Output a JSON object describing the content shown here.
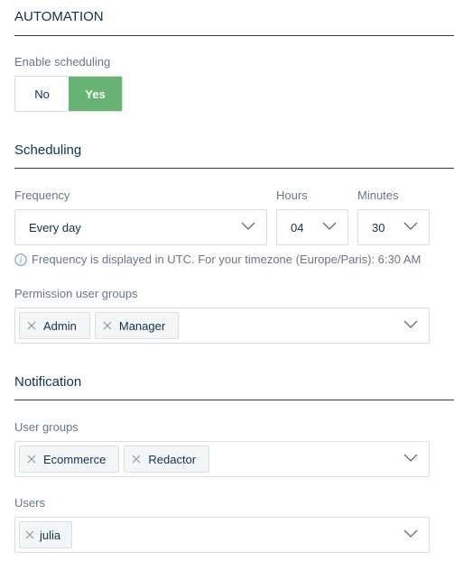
{
  "automation": {
    "title": "AUTOMATION",
    "enable_scheduling_label": "Enable scheduling",
    "toggle": {
      "no_label": "No",
      "yes_label": "Yes",
      "selected": "Yes"
    }
  },
  "scheduling": {
    "title": "Scheduling",
    "frequency": {
      "label": "Frequency",
      "value": "Every day"
    },
    "hours": {
      "label": "Hours",
      "value": "04"
    },
    "minutes": {
      "label": "Minutes",
      "value": "30"
    },
    "info": "Frequency is displayed in UTC. For your timezone (Europe/Paris): 6:30 AM",
    "permission_groups": {
      "label": "Permission user groups",
      "tags": [
        "Admin",
        "Manager"
      ]
    }
  },
  "notification": {
    "title": "Notification",
    "user_groups": {
      "label": "User groups",
      "tags": [
        "Ecommerce",
        "Redactor"
      ]
    },
    "users": {
      "label": "Users",
      "tags": [
        "julia"
      ]
    }
  },
  "colors": {
    "accent_green": "#67b373",
    "text_dark": "#11324d",
    "text_muted": "#67768a",
    "border": "#d9dde2"
  },
  "icons": [
    "chevron-down-icon",
    "info-icon",
    "close-icon"
  ]
}
